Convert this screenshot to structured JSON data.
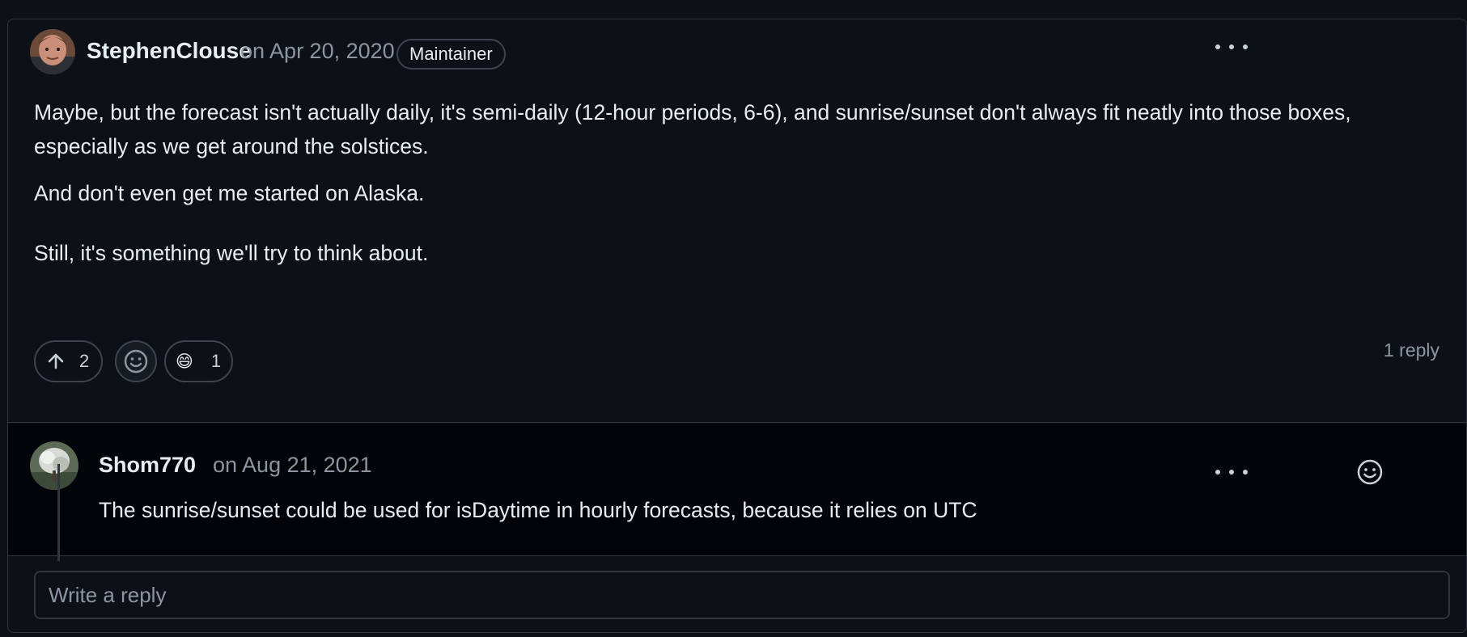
{
  "comment": {
    "author": "StephenClouse",
    "date": "on Apr 20, 2020",
    "badge": "Maintainer",
    "avatar_icon": "user-avatar-icon",
    "paragraphs": [
      "Maybe, but the forecast isn't actually daily, it's semi-daily (12-hour periods, 6-6), and sunrise/sunset don't always fit neatly into those boxes, especially as we get around the solstices.",
      "And don't even get me started on Alaska.",
      "Still, it's something we'll try to think about."
    ],
    "reactions": {
      "upvote_count": "2",
      "emoji": "😄",
      "emoji_count": "1"
    },
    "replies_count": "1 reply"
  },
  "reply": {
    "author": "Shom770",
    "date": "on Aug 21, 2021",
    "text": "The sunrise/sunset could be used for isDaytime in hourly forecasts, because it relies on UTC"
  },
  "reply_box": {
    "placeholder": "Write a reply"
  },
  "colors": {
    "background": "#0d1117",
    "reply_background": "#010409",
    "border": "#30363d",
    "muted_text": "#8d96a0",
    "text": "#e6edf3"
  }
}
